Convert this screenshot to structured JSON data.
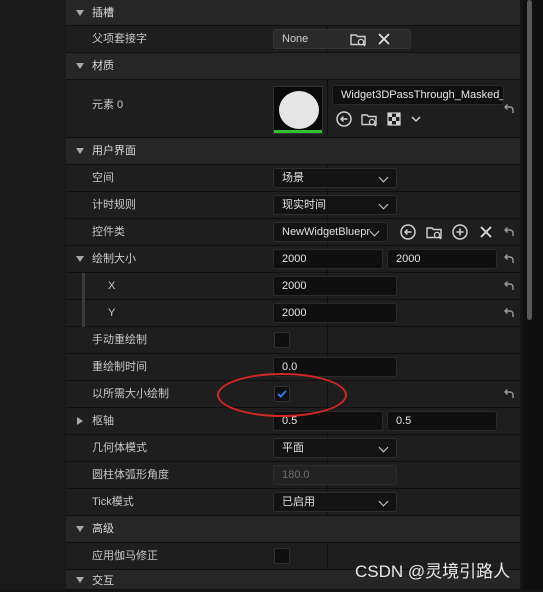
{
  "sections": {
    "slot": "插槽",
    "material": "材质",
    "ui": "用户界面",
    "advanced": "高级",
    "interaction": "交互"
  },
  "rows": {
    "parent_socket": {
      "label": "父项套接字",
      "value": "None"
    },
    "element0": {
      "label": "元素 0",
      "value": "Widget3DPassThrough_Masked_"
    },
    "space": {
      "label": "空间",
      "value": "场景"
    },
    "timing_policy": {
      "label": "计时规则",
      "value": "现实时间"
    },
    "widget_class": {
      "label": "控件类",
      "value": "NewWidgetBluepr"
    },
    "draw_size": {
      "label": "绘制大小",
      "x": "2000",
      "y": "2000"
    },
    "draw_size_x": {
      "label": "X",
      "value": "2000"
    },
    "draw_size_y": {
      "label": "Y",
      "value": "2000"
    },
    "manual_redraw": {
      "label": "手动重绘制",
      "checked": false
    },
    "redraw_time": {
      "label": "重绘制时间",
      "value": "0.0"
    },
    "draw_at_desired_size": {
      "label": "以所需大小绘制",
      "checked": true
    },
    "pivot": {
      "label": "枢轴",
      "x": "0.5",
      "y": "0.5"
    },
    "geometry_mode": {
      "label": "几何体模式",
      "value": "平面"
    },
    "cylinder_arc_angle": {
      "label": "圆柱体弧形角度",
      "value": "180.0"
    },
    "tick_mode": {
      "label": "Tick模式",
      "value": "已启用"
    },
    "apply_gamma": {
      "label": "应用伽马修正",
      "checked": false
    }
  },
  "watermark": "CSDN @灵境引路人",
  "colors": {
    "accent": "#2fc12f",
    "annotation": "#d12626",
    "checkmark": "#2f8bff"
  }
}
